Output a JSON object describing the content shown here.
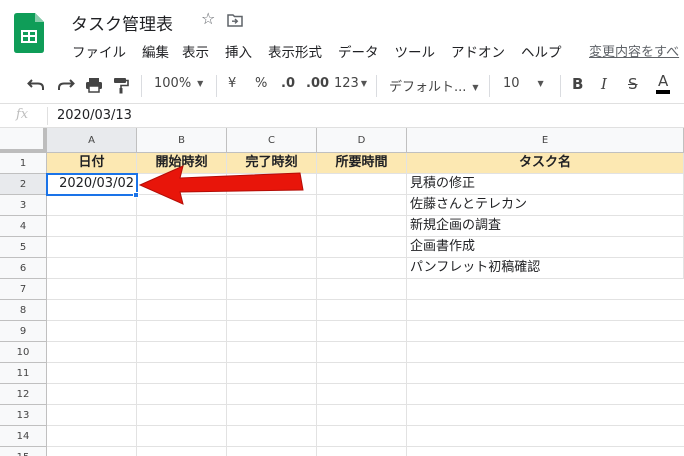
{
  "document": {
    "title": "タスク管理表"
  },
  "menu": [
    "ファイル",
    "編集",
    "表示",
    "挿入",
    "表示形式",
    "データ",
    "ツール",
    "アドオン",
    "ヘルプ"
  ],
  "last_edit": "変更内容をすべ",
  "toolbar": {
    "zoom": "100%",
    "currency": "¥",
    "percent": "%",
    "decimal_decrease": ".0",
    "decimal_increase": ".00",
    "more_formats": "123",
    "font": "デフォルト...",
    "font_size": "10",
    "bold": "B",
    "italic": "I",
    "strikethrough": "S",
    "text_color": "A"
  },
  "formula_bar": {
    "label": "fx",
    "value": "2020/03/13"
  },
  "columns": [
    "A",
    "B",
    "C",
    "D",
    "E"
  ],
  "rows": [
    "1",
    "2",
    "3",
    "4",
    "5",
    "6",
    "7",
    "8",
    "9",
    "10",
    "11",
    "12",
    "13",
    "14",
    "15"
  ],
  "header_row": [
    "日付",
    "開始時刻",
    "完了時刻",
    "所要時間",
    "タスク名"
  ],
  "cells": {
    "a2": "2020/03/02",
    "e2": "見積の修正",
    "e3": "佐藤さんとテレカン",
    "e4": "新規企画の調査",
    "e5": "企画書作成",
    "e6": "パンフレット初稿確認"
  },
  "colors": {
    "header_fill": "#fce8b2",
    "selection": "#1a73e8",
    "annotation_arrow": "#e8150a"
  }
}
